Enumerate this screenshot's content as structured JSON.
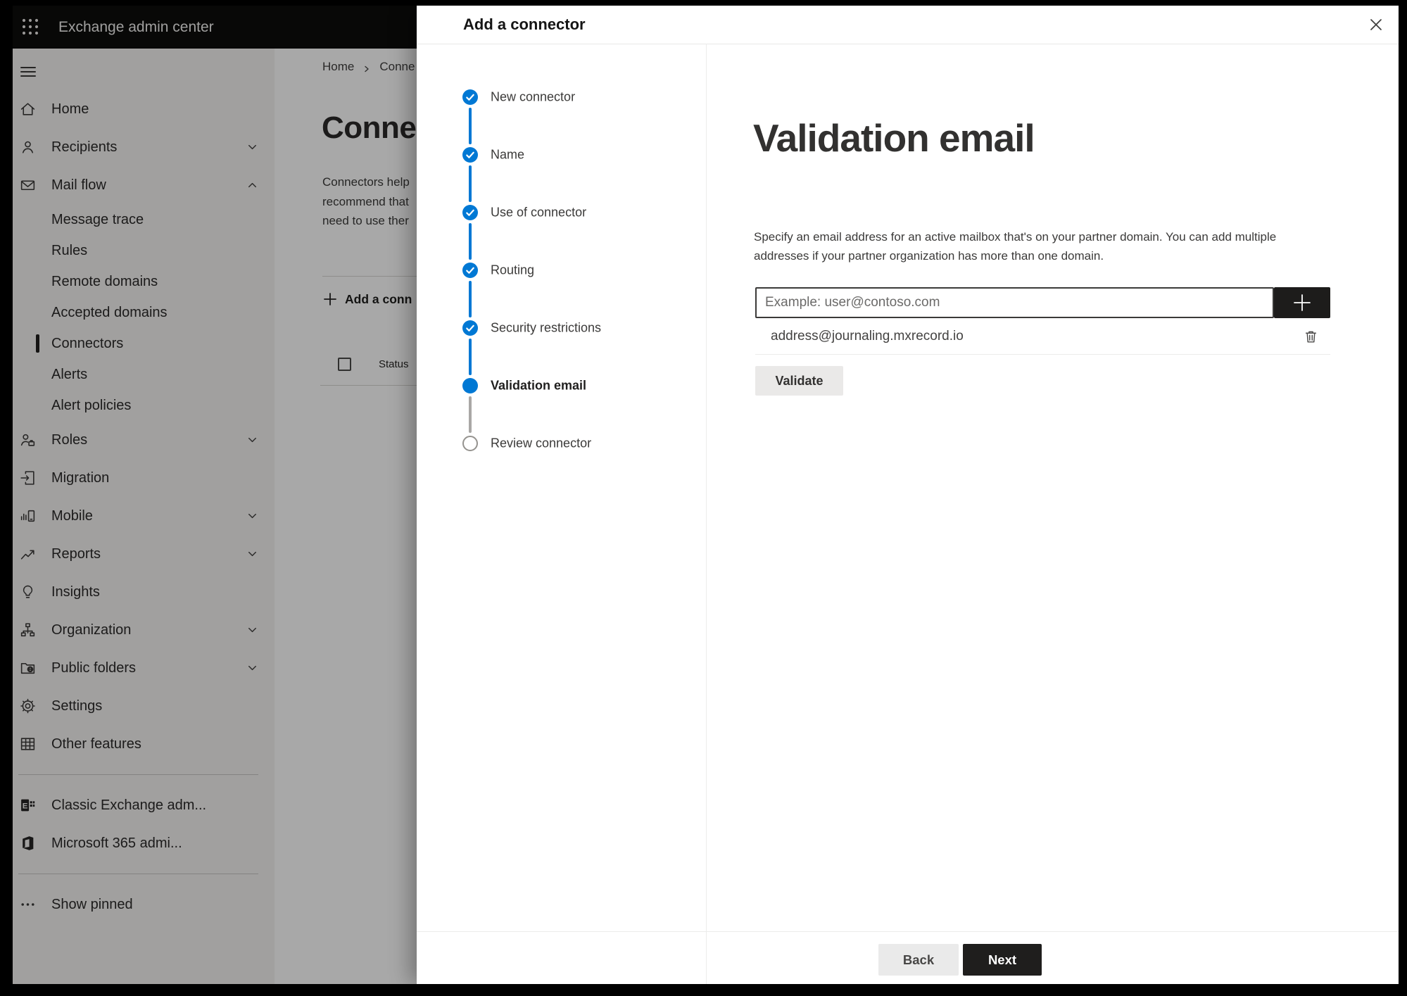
{
  "topbar": {
    "title": "Exchange admin center",
    "waffle_icon": "app-launcher"
  },
  "sidebar": {
    "items": [
      {
        "label": "Home",
        "icon": "home",
        "level": 1
      },
      {
        "label": "Recipients",
        "icon": "recipients",
        "level": 1,
        "chevron": "down"
      },
      {
        "label": "Mail flow",
        "icon": "mail-flow",
        "level": 1,
        "chevron": "up"
      },
      {
        "label": "Message trace",
        "level": 2
      },
      {
        "label": "Rules",
        "level": 2
      },
      {
        "label": "Remote domains",
        "level": 2
      },
      {
        "label": "Accepted domains",
        "level": 2
      },
      {
        "label": "Connectors",
        "level": 2,
        "selected": true
      },
      {
        "label": "Alerts",
        "level": 2
      },
      {
        "label": "Alert policies",
        "level": 2
      },
      {
        "label": "Roles",
        "icon": "roles",
        "level": 1,
        "chevron": "down"
      },
      {
        "label": "Migration",
        "icon": "migration",
        "level": 1
      },
      {
        "label": "Mobile",
        "icon": "mobile",
        "level": 1,
        "chevron": "down"
      },
      {
        "label": "Reports",
        "icon": "reports",
        "level": 1,
        "chevron": "down"
      },
      {
        "label": "Insights",
        "icon": "insights",
        "level": 1
      },
      {
        "label": "Organization",
        "icon": "organization",
        "level": 1,
        "chevron": "down"
      },
      {
        "label": "Public folders",
        "icon": "public-folders",
        "level": 1,
        "chevron": "down"
      },
      {
        "label": "Settings",
        "icon": "settings",
        "level": 1
      },
      {
        "label": "Other features",
        "icon": "other-features",
        "level": 1
      },
      {
        "divider": true
      },
      {
        "label": "Classic Exchange adm...",
        "icon": "classic-exchange",
        "level": 1
      },
      {
        "label": "Microsoft 365 admi...",
        "icon": "microsoft-365",
        "level": 1
      },
      {
        "divider": true
      },
      {
        "label": "Show pinned",
        "icon": "more",
        "level": 1
      }
    ]
  },
  "page": {
    "breadcrumb": [
      "Home",
      "Conne"
    ],
    "title": "Connect",
    "description_lines": [
      "Connectors help",
      "recommend that",
      "need to use ther"
    ],
    "add_button": "Add a conn",
    "table": {
      "column": "Status"
    }
  },
  "modal": {
    "title": "Add a connector",
    "close_icon": "close",
    "steps": [
      {
        "label": "New connector",
        "state": "completed"
      },
      {
        "label": "Name",
        "state": "completed"
      },
      {
        "label": "Use of connector",
        "state": "completed"
      },
      {
        "label": "Routing",
        "state": "completed"
      },
      {
        "label": "Security restrictions",
        "state": "completed"
      },
      {
        "label": "Validation email",
        "state": "current"
      },
      {
        "label": "Review connector",
        "state": "upcoming"
      }
    ],
    "content": {
      "heading": "Validation email",
      "description": "Specify an email address for an active mailbox that's on your partner domain. You can add multiple addresses if your partner organization has more than one domain.",
      "email_input_value": "",
      "email_input_placeholder": "Example: user@contoso.com",
      "add_icon": "plus",
      "addresses": [
        "address@journaling.mxrecord.io"
      ],
      "delete_icon": "trash",
      "validate_button": "Validate"
    },
    "footer": {
      "back": "Back",
      "next": "Next"
    }
  },
  "colors": {
    "accent": "#0078d4",
    "topbar_bg": "#0d0d0c",
    "primary_button_bg": "#1f1e1d",
    "step_upcoming_border": "#95938f"
  }
}
